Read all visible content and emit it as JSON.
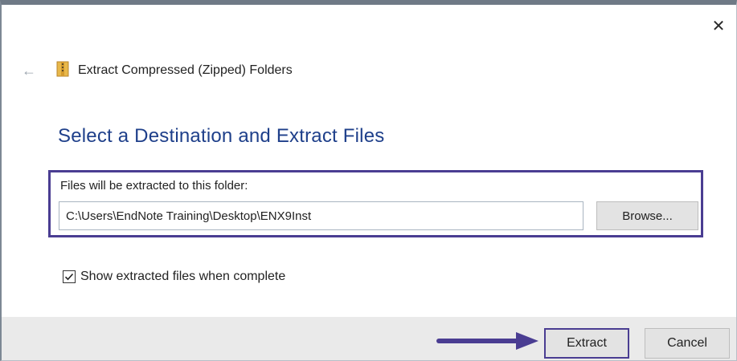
{
  "window": {
    "close_glyph": "✕",
    "back_glyph": "←",
    "title": "Extract Compressed (Zipped) Folders"
  },
  "main": {
    "heading": "Select a Destination and Extract Files",
    "destination_label": "Files will be extracted to this folder:",
    "destination_path": "C:\\Users\\EndNote Training\\Desktop\\ENX9Inst",
    "browse_label": "Browse...",
    "show_files_label": "Show extracted files when complete",
    "show_files_checked": true
  },
  "footer": {
    "extract_label": "Extract",
    "cancel_label": "Cancel"
  },
  "icons": {
    "back": "back-arrow-icon",
    "zip": "zip-folder-icon",
    "close": "close-icon",
    "check": "checkmark-icon",
    "pointer": "pointer-arrow-icon"
  },
  "colors": {
    "heading": "#1e3f8a",
    "highlight": "#4a3d92",
    "footer_bg": "#eaeaea",
    "button_bg": "#e3e3e3"
  }
}
